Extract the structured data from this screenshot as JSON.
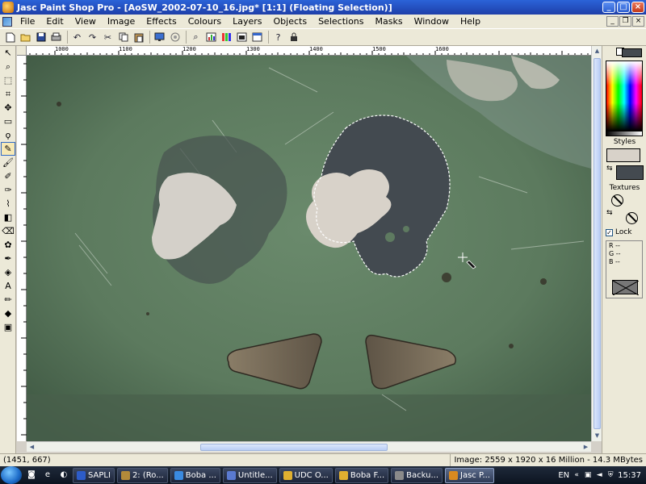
{
  "window": {
    "title": "Jasc Paint Shop Pro - [AoSW_2002-07-10_16.jpg* [1:1] (Floating Selection)]",
    "min_glyph": "_",
    "max_glyph": "□",
    "close_glyph": "×"
  },
  "menu": [
    "File",
    "Edit",
    "View",
    "Image",
    "Effects",
    "Colours",
    "Layers",
    "Objects",
    "Selections",
    "Masks",
    "Window",
    "Help"
  ],
  "toolbar_icons": [
    "new-icon",
    "open-icon",
    "save-icon",
    "print-icon",
    "undo-icon",
    "redo-icon",
    "cut-icon",
    "copy-icon",
    "paste-icon",
    "browse-icon",
    "screen-capture-icon",
    "zoom-icon",
    "histogram-icon",
    "color-palette-icon",
    "layers-palette-icon",
    "overview-icon",
    "help-icon",
    "lock-icon"
  ],
  "tools": [
    "arrow-tool",
    "zoom-tool",
    "select-tool",
    "crop-tool",
    "mover-tool",
    "rect-select-tool",
    "lasso-tool",
    "dropper-tool",
    "paint-brush-tool",
    "clone-brush-tool",
    "color-replacer-tool",
    "retouch-tool",
    "scratch-remover-tool",
    "eraser-tool",
    "picture-tube-tool",
    "airbrush-tool",
    "flood-fill-tool",
    "text-tool",
    "draw-tool",
    "preset-shapes-tool",
    "object-selector-tool"
  ],
  "ruler": {
    "labels": [
      "1000",
      "1100",
      "1200",
      "1300",
      "1400",
      "1500",
      "1600"
    ]
  },
  "right_panel": {
    "styles_label": "Styles",
    "textures_label": "Textures",
    "lock_label": "Lock",
    "lock_mark": "✓",
    "rgb": {
      "r": "R  --",
      "g": "G  --",
      "b": "B  --"
    },
    "fg_color": "#d8d2c9",
    "bg_color": "#444a50"
  },
  "status": {
    "coords": "(1451, 667)",
    "image_info": "Image:  2559 x 1920 x 16 Million - 14.3 MBytes"
  },
  "taskbar": {
    "tasks": [
      {
        "label": "SAPLI",
        "color": "#2d5cc8"
      },
      {
        "label": "2: (Ro...",
        "color": "#b38a3a"
      },
      {
        "label": "Boba ...",
        "color": "#3a8ae0"
      },
      {
        "label": "Untitle...",
        "color": "#5a7ad0"
      },
      {
        "label": "UDC O...",
        "color": "#e0b030"
      },
      {
        "label": "Boba F...",
        "color": "#e0b030"
      },
      {
        "label": "Backu...",
        "color": "#8a8a8a"
      },
      {
        "label": "Jasc P...",
        "color": "#d98a20",
        "active": true
      }
    ],
    "lang": "EN",
    "clock": "15:37"
  }
}
